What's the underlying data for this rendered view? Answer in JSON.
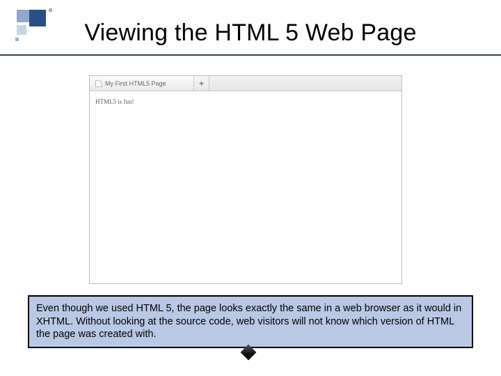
{
  "slide": {
    "title": "Viewing the HTML 5 Web Page",
    "caption": "Even though we used HTML 5, the page looks exactly the same in a web browser as it would in XHTML.  Without looking at the source code, web visitors will not know which version of HTML the page was created with."
  },
  "browser": {
    "tab_title": "My First HTML5 Page",
    "new_tab_label": "+",
    "page_text": "HTML5 is fun!"
  }
}
